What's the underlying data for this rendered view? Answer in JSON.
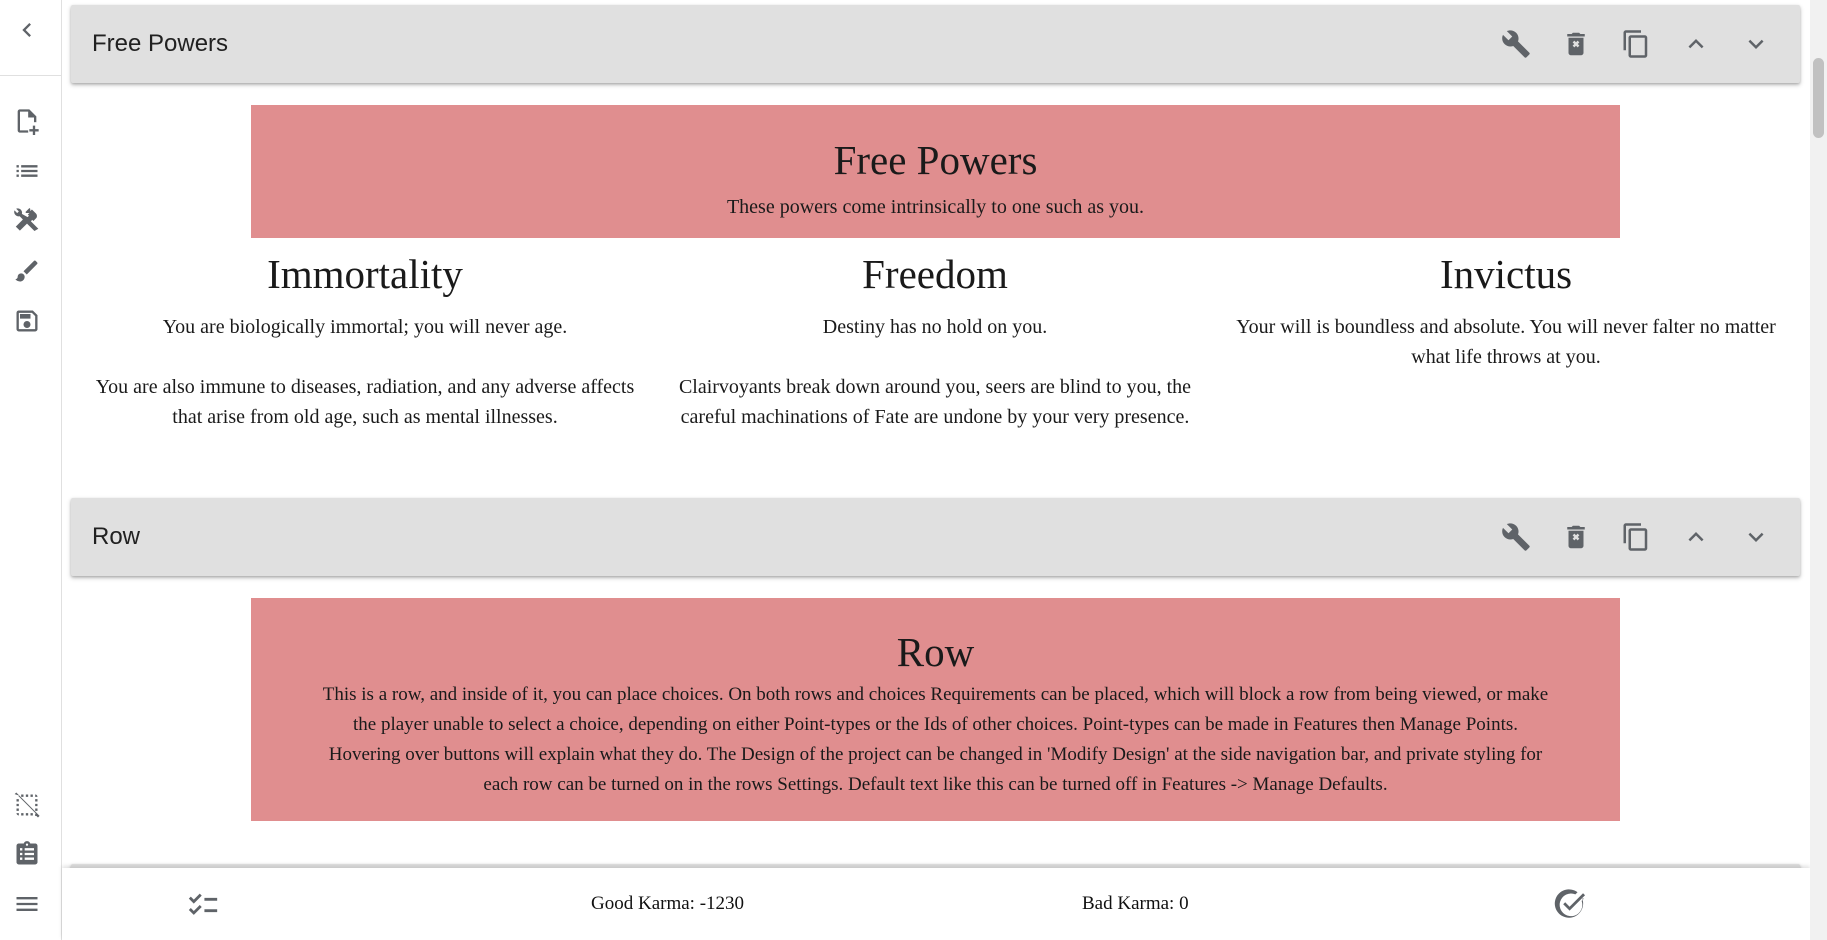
{
  "rail": {
    "back_icon": "chevron-left-icon",
    "items": [
      "new-file-icon",
      "list-icon",
      "tools-icon",
      "brush-icon",
      "save-icon"
    ],
    "bottom_items": [
      "select-off-icon",
      "clipboard-list-icon",
      "menu-icon"
    ]
  },
  "rows": [
    {
      "bar_title": "Free Powers",
      "header_title": "Free Powers",
      "header_text": "These powers come intrinsically to one such as you.",
      "choices": [
        {
          "title": "Immortality",
          "p1": "You are biologically immortal; you will never age.",
          "p2": "You are also immune to diseases, radiation, and any adverse affects that arise from old age, such as mental illnesses."
        },
        {
          "title": "Freedom",
          "p1": "Destiny has no hold on you.",
          "p2": "Clairvoyants break down around you, seers are blind to you, the careful machinations of Fate are undone by your very presence."
        },
        {
          "title": "Invictus",
          "p1": "Your will is boundless and absolute. You will never falter no matter what life throws at you.",
          "p2": ""
        }
      ]
    },
    {
      "bar_title": "Row",
      "header_title": "Row",
      "header_text": "This is a row, and inside of it, you can place choices. On both rows and choices Requirements can be placed, which will block a row from being viewed, or make the player unable to select a choice, depending on either Point-types or the Ids of other choices. Point-types can be made in Features then Manage Points. Hovering over buttons will explain what they do. The Design of the project can be changed in 'Modify Design' at the side navigation bar, and private styling for each row can be turned on in the rows Settings. Default text like this can be turned off in Features -> Manage Defaults."
    }
  ],
  "row_actions": [
    "wrench-icon",
    "delete-icon",
    "copy-icon",
    "chevron-up-icon",
    "chevron-down-icon"
  ],
  "bottom": {
    "good_karma": "Good Karma: -1230",
    "bad_karma": "Bad Karma: 0",
    "left_icon": "checklist-icon",
    "right_icon": "check-circle-icon"
  },
  "colors": {
    "pink": "#e08e8f",
    "bar": "#e0e0e0",
    "icon": "#5f6368"
  }
}
